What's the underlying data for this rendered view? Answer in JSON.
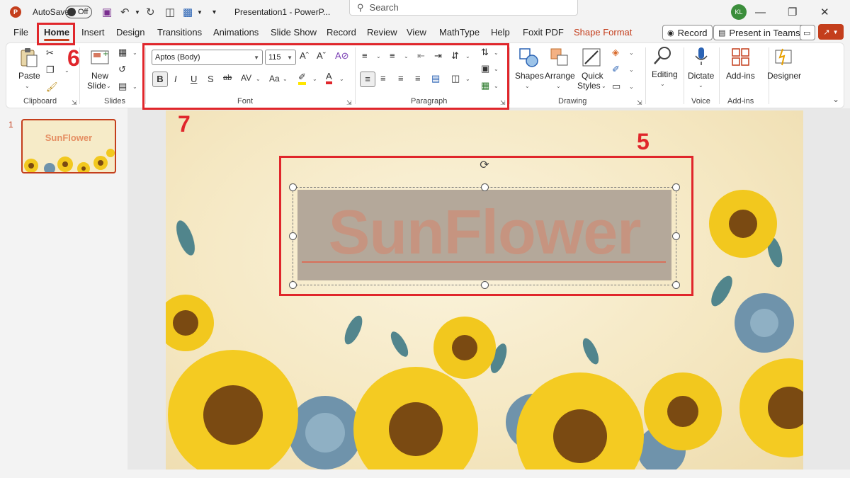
{
  "titlebar": {
    "autosave_label": "AutoSave",
    "autosave_state": "Off",
    "doc_title": "Presentation1 - PowerP...",
    "search_placeholder": "Search",
    "user_initials": "KL"
  },
  "tabs": [
    "File",
    "Home",
    "Insert",
    "Design",
    "Transitions",
    "Animations",
    "Slide Show",
    "Record",
    "Review",
    "View",
    "MathType",
    "Help",
    "Foxit PDF",
    "Shape Format"
  ],
  "header_buttons": {
    "record": "Record",
    "present_in_teams": "Present in Teams"
  },
  "ribbon": {
    "clipboard": {
      "paste": "Paste",
      "label": "Clipboard"
    },
    "slides": {
      "new_slide_line1": "New",
      "new_slide_line2": "Slide",
      "label": "Slides"
    },
    "font": {
      "font_name": "Aptos (Body)",
      "font_size": "115",
      "bold": "B",
      "italic": "I",
      "underline": "U",
      "strike": "S",
      "abc": "ab",
      "spacing": "AV",
      "case": "Aa",
      "label": "Font"
    },
    "paragraph": {
      "label": "Paragraph"
    },
    "drawing": {
      "shapes": "Shapes",
      "arrange": "Arrange",
      "quick_styles_line1": "Quick",
      "quick_styles_line2": "Styles",
      "label": "Drawing"
    },
    "editing": {
      "editing": "Editing"
    },
    "voice": {
      "dictate": "Dictate",
      "label": "Voice"
    },
    "addins": {
      "addins": "Add-ins",
      "label": "Add-ins"
    },
    "designer": {
      "designer": "Designer"
    }
  },
  "slides_panel": {
    "slide_number": "1",
    "thumb_title": "SunFlower"
  },
  "slide": {
    "title_text": "SunFlower"
  },
  "annotations": {
    "home_tab": "6",
    "font_paragraph": "7",
    "text_box": "5"
  },
  "colors": {
    "accent": "#c43e1c",
    "annotation": "#e0262b",
    "title_text": "#c69480"
  }
}
